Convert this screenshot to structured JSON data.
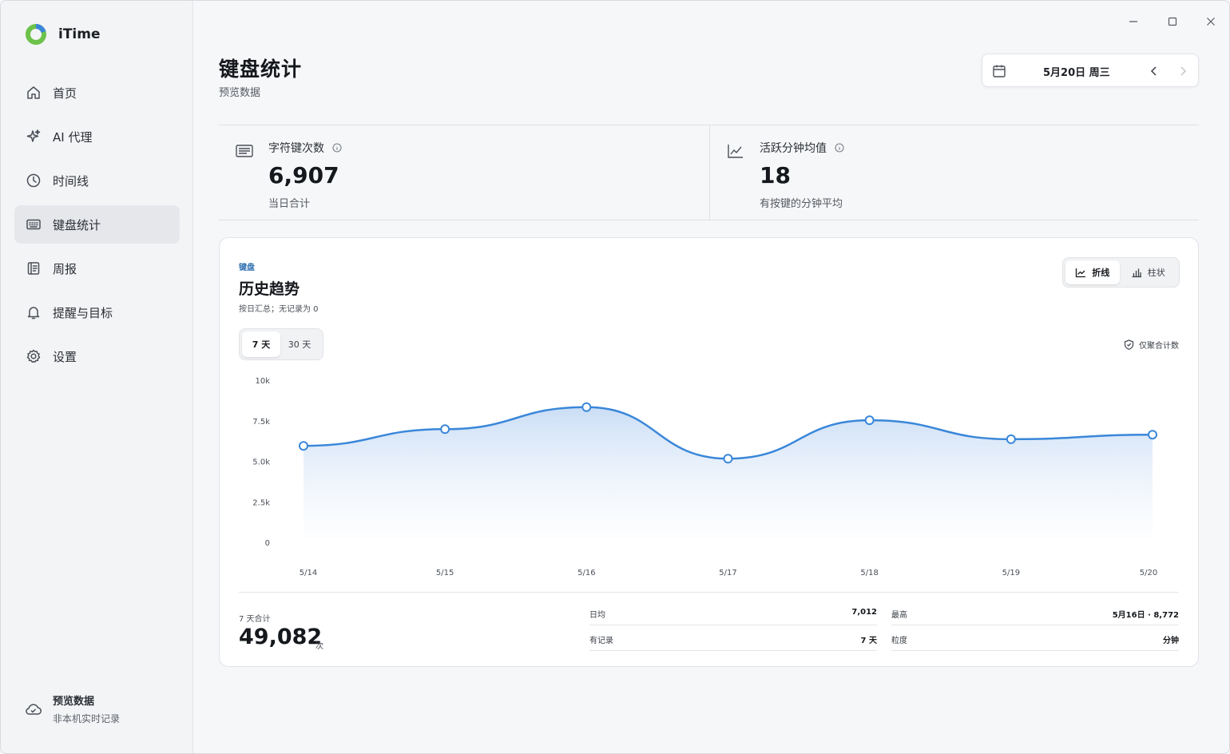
{
  "app": {
    "name": "iTime"
  },
  "sidebar": {
    "items": [
      {
        "label": "首页",
        "icon": "home-icon"
      },
      {
        "label": "AI 代理",
        "icon": "sparkle-icon"
      },
      {
        "label": "时间线",
        "icon": "clock-icon"
      },
      {
        "label": "键盘统计",
        "icon": "keyboard-icon",
        "active": true
      },
      {
        "label": "周报",
        "icon": "report-icon"
      },
      {
        "label": "提醒与目标",
        "icon": "bell-icon"
      },
      {
        "label": "设置",
        "icon": "gear-icon"
      }
    ],
    "footer": {
      "title": "预览数据",
      "subtitle": "非本机实时记录",
      "icon": "cloud-check-icon"
    }
  },
  "header": {
    "title": "键盘统计",
    "subtitle": "预览数据",
    "date": "5月20日 周三"
  },
  "stats": [
    {
      "label": "字符键次数",
      "value": "6,907",
      "note": "当日合计",
      "icon": "keyboard-icon"
    },
    {
      "label": "活跃分钟均值",
      "value": "18",
      "note": "有按键的分钟平均",
      "icon": "trend-icon"
    }
  ],
  "card": {
    "tag": "键盘",
    "title": "历史趋势",
    "subtitle": "按日汇总；无记录为 0",
    "chart_types": [
      {
        "label": "折线",
        "active": true
      },
      {
        "label": "柱状",
        "active": false
      }
    ],
    "ranges": [
      {
        "label": "7 天",
        "active": true
      },
      {
        "label": "30 天",
        "active": false
      }
    ],
    "only_note": "仅聚合计数",
    "summary": {
      "total_label": "7 天合计",
      "total_value": "49,082",
      "total_unit": "次",
      "rows": [
        {
          "k": "日均",
          "v": "7,012"
        },
        {
          "k": "最高",
          "v": "5月16日 · 8,772"
        },
        {
          "k": "有记录",
          "v": "7 天"
        },
        {
          "k": "粒度",
          "v": "分钟"
        }
      ]
    }
  },
  "colors": {
    "accent": "#3a87d9",
    "fill_top": "#cfe0f6"
  },
  "chart_data": {
    "type": "area",
    "categories": [
      "5/14",
      "5/15",
      "5/16",
      "5/17",
      "5/18",
      "5/19",
      "5/20"
    ],
    "series": [
      {
        "values": [
          5950,
          6980,
          8340,
          5160,
          7530,
          6360,
          6640
        ]
      }
    ],
    "y_ticks": [
      "0",
      "2.5k",
      "5.0k",
      "7.5k",
      "10k"
    ],
    "ylim": [
      0,
      10000
    ],
    "grid": false
  }
}
